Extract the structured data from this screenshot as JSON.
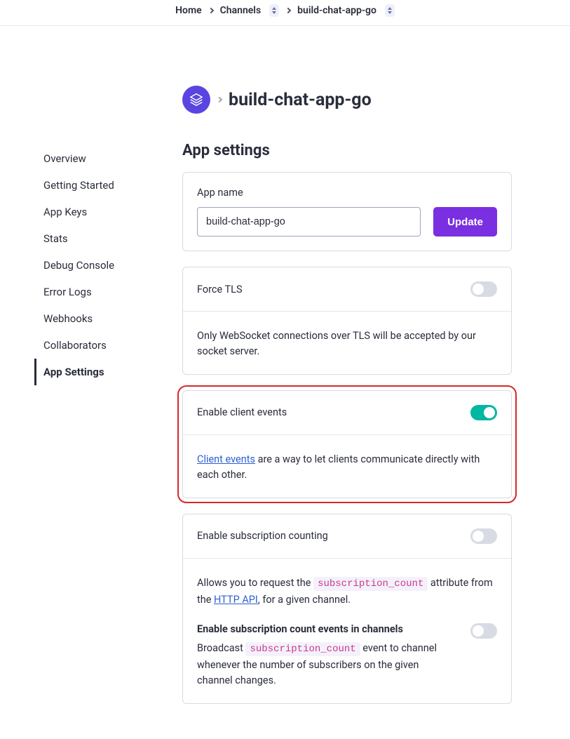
{
  "breadcrumb": {
    "home": "Home",
    "mid": "Channels",
    "leaf": "build-chat-app-go"
  },
  "header": {
    "app_name": "build-chat-app-go"
  },
  "page_title": "App settings",
  "sidebar": {
    "items": [
      {
        "label": "Overview"
      },
      {
        "label": "Getting Started"
      },
      {
        "label": "App Keys"
      },
      {
        "label": "Stats"
      },
      {
        "label": "Debug Console"
      },
      {
        "label": "Error Logs"
      },
      {
        "label": "Webhooks"
      },
      {
        "label": "Collaborators"
      },
      {
        "label": "App Settings"
      }
    ],
    "active_index": 8
  },
  "cards": {
    "app_name": {
      "label": "App name",
      "value": "build-chat-app-go",
      "button": "Update"
    },
    "force_tls": {
      "title": "Force TLS",
      "enabled": false,
      "desc": "Only WebSocket connections over TLS will be accepted by our socket server."
    },
    "client_events": {
      "title": "Enable client events",
      "enabled": true,
      "link_text": "Client events",
      "desc_suffix": " are a way to let clients communicate directly with each other."
    },
    "sub_count": {
      "title": "Enable subscription counting",
      "enabled": false,
      "desc_pre": "Allows you to request the ",
      "code": "subscription_count",
      "desc_mid": " attribute from the ",
      "api_link": "HTTP API",
      "desc_post": ", for a given channel.",
      "sub_events_title": "Enable subscription count events in channels",
      "sub_events_enabled": false,
      "sub_events_pre": "Broadcast ",
      "sub_events_code": "subscription_count",
      "sub_events_post": " event to channel whenever the number of subscribers on the given channel changes."
    }
  }
}
